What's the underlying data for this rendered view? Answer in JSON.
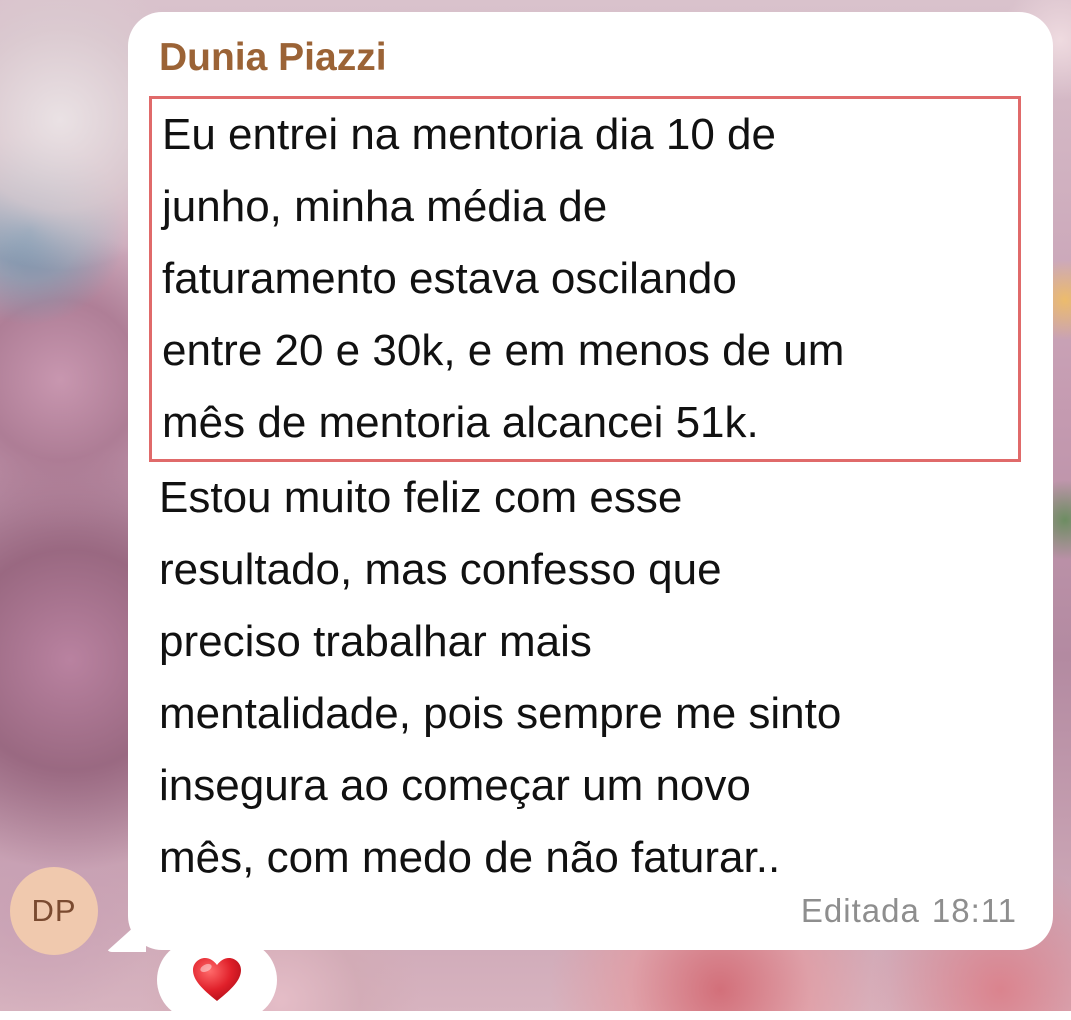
{
  "chat": {
    "avatar_initials": "DP",
    "sender_name": "Dunia Piazzi",
    "message": {
      "highlighted_lines": [
        "Eu entrei na mentoria dia 10 de",
        "junho, minha média de",
        "faturamento estava oscilando",
        "entre 20 e 30k, e em menos de um",
        "mês de mentoria alcancei 51k."
      ],
      "lines": [
        "Estou muito feliz com esse",
        "resultado, mas confesso que",
        "preciso trabalhar mais",
        "mentalidade, pois sempre me sinto",
        "insegura ao começar um novo",
        "mês, com medo de não faturar.."
      ]
    },
    "edited_label": "Editada",
    "time": "18:11",
    "reaction": "heart-icon",
    "colors": {
      "sender_name": "#9b6336",
      "highlight_border": "#e06a6a",
      "avatar_bg": "#f0c9ae",
      "bubble_bg": "#ffffff",
      "meta_text": "#8e8e8e",
      "heart": "#e0202a"
    }
  }
}
